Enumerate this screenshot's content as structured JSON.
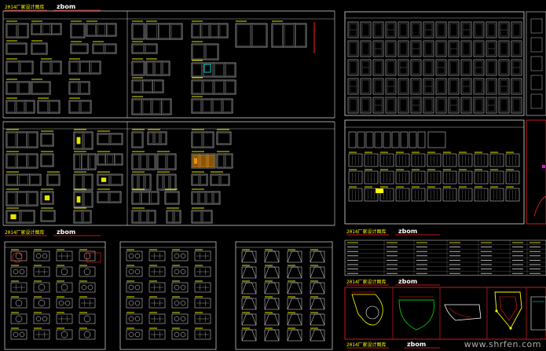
{
  "titles": {
    "t1": "2014厂家设计图库",
    "t2": "2014厂家设计图库",
    "t3": "2014厂家设计图库",
    "t4": "2014厂家设计图库",
    "t5": "2014厂家设计图库"
  },
  "logo_text": "zbom",
  "watermark": "www.shrfen.com",
  "colors": {
    "background": "#000000",
    "line": "#e8e8e8",
    "accent_yellow": "#ffff00",
    "accent_red": "#ff2020",
    "accent_green": "#00c800",
    "accent_orange": "#ff9900",
    "accent_cyan": "#00ffff",
    "accent_magenta": "#ff00ff"
  }
}
